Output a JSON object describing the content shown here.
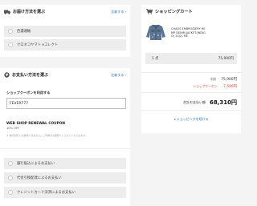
{
  "delivery": {
    "title": "お届け方法を選ぶ",
    "change_label": "比較する",
    "options": [
      "西濃運輸",
      "クロネコヤマト eコレクト"
    ]
  },
  "payment": {
    "title": "お支払い方法を選ぶ",
    "change_label": "比較する",
    "coupon_label": "ショップクーポンを利用する",
    "coupon_code": "FEVER777",
    "coupon_name": "WEB SHOP RENEWAL COUPON",
    "coupon_discount": "10% OFF",
    "coupon_note": "※ 他の割引とは併用できません。ご利用は1回限りとさせていただきます。",
    "methods": [
      "銀行振込によるお支払い",
      "代金引換配達によるお支払い",
      "クレジットカード決済によるお支払い"
    ]
  },
  "cart": {
    "title": "ショッピングカート",
    "item_name_lines": [
      "CHAOS EMBROIDERY HE",
      "MP DENIM JACKET(INDIG",
      "O) 15(2) ME"
    ],
    "quantity": "1 点",
    "item_price": "75,900円",
    "subtotal_label": "小計",
    "subtotal_value": "75,900円",
    "coupon_label": "ショップクーポン",
    "coupon_value": "-7,590円",
    "total_label": "合計お支払い額",
    "total_value": "68,310円",
    "continue_label": "◂ ショッピングを続ける"
  },
  "colors": {
    "link": "#2a6cb8",
    "discount": "#e03a3a",
    "option_bg": "#ededed",
    "page_bg": "#f4f4f4"
  }
}
